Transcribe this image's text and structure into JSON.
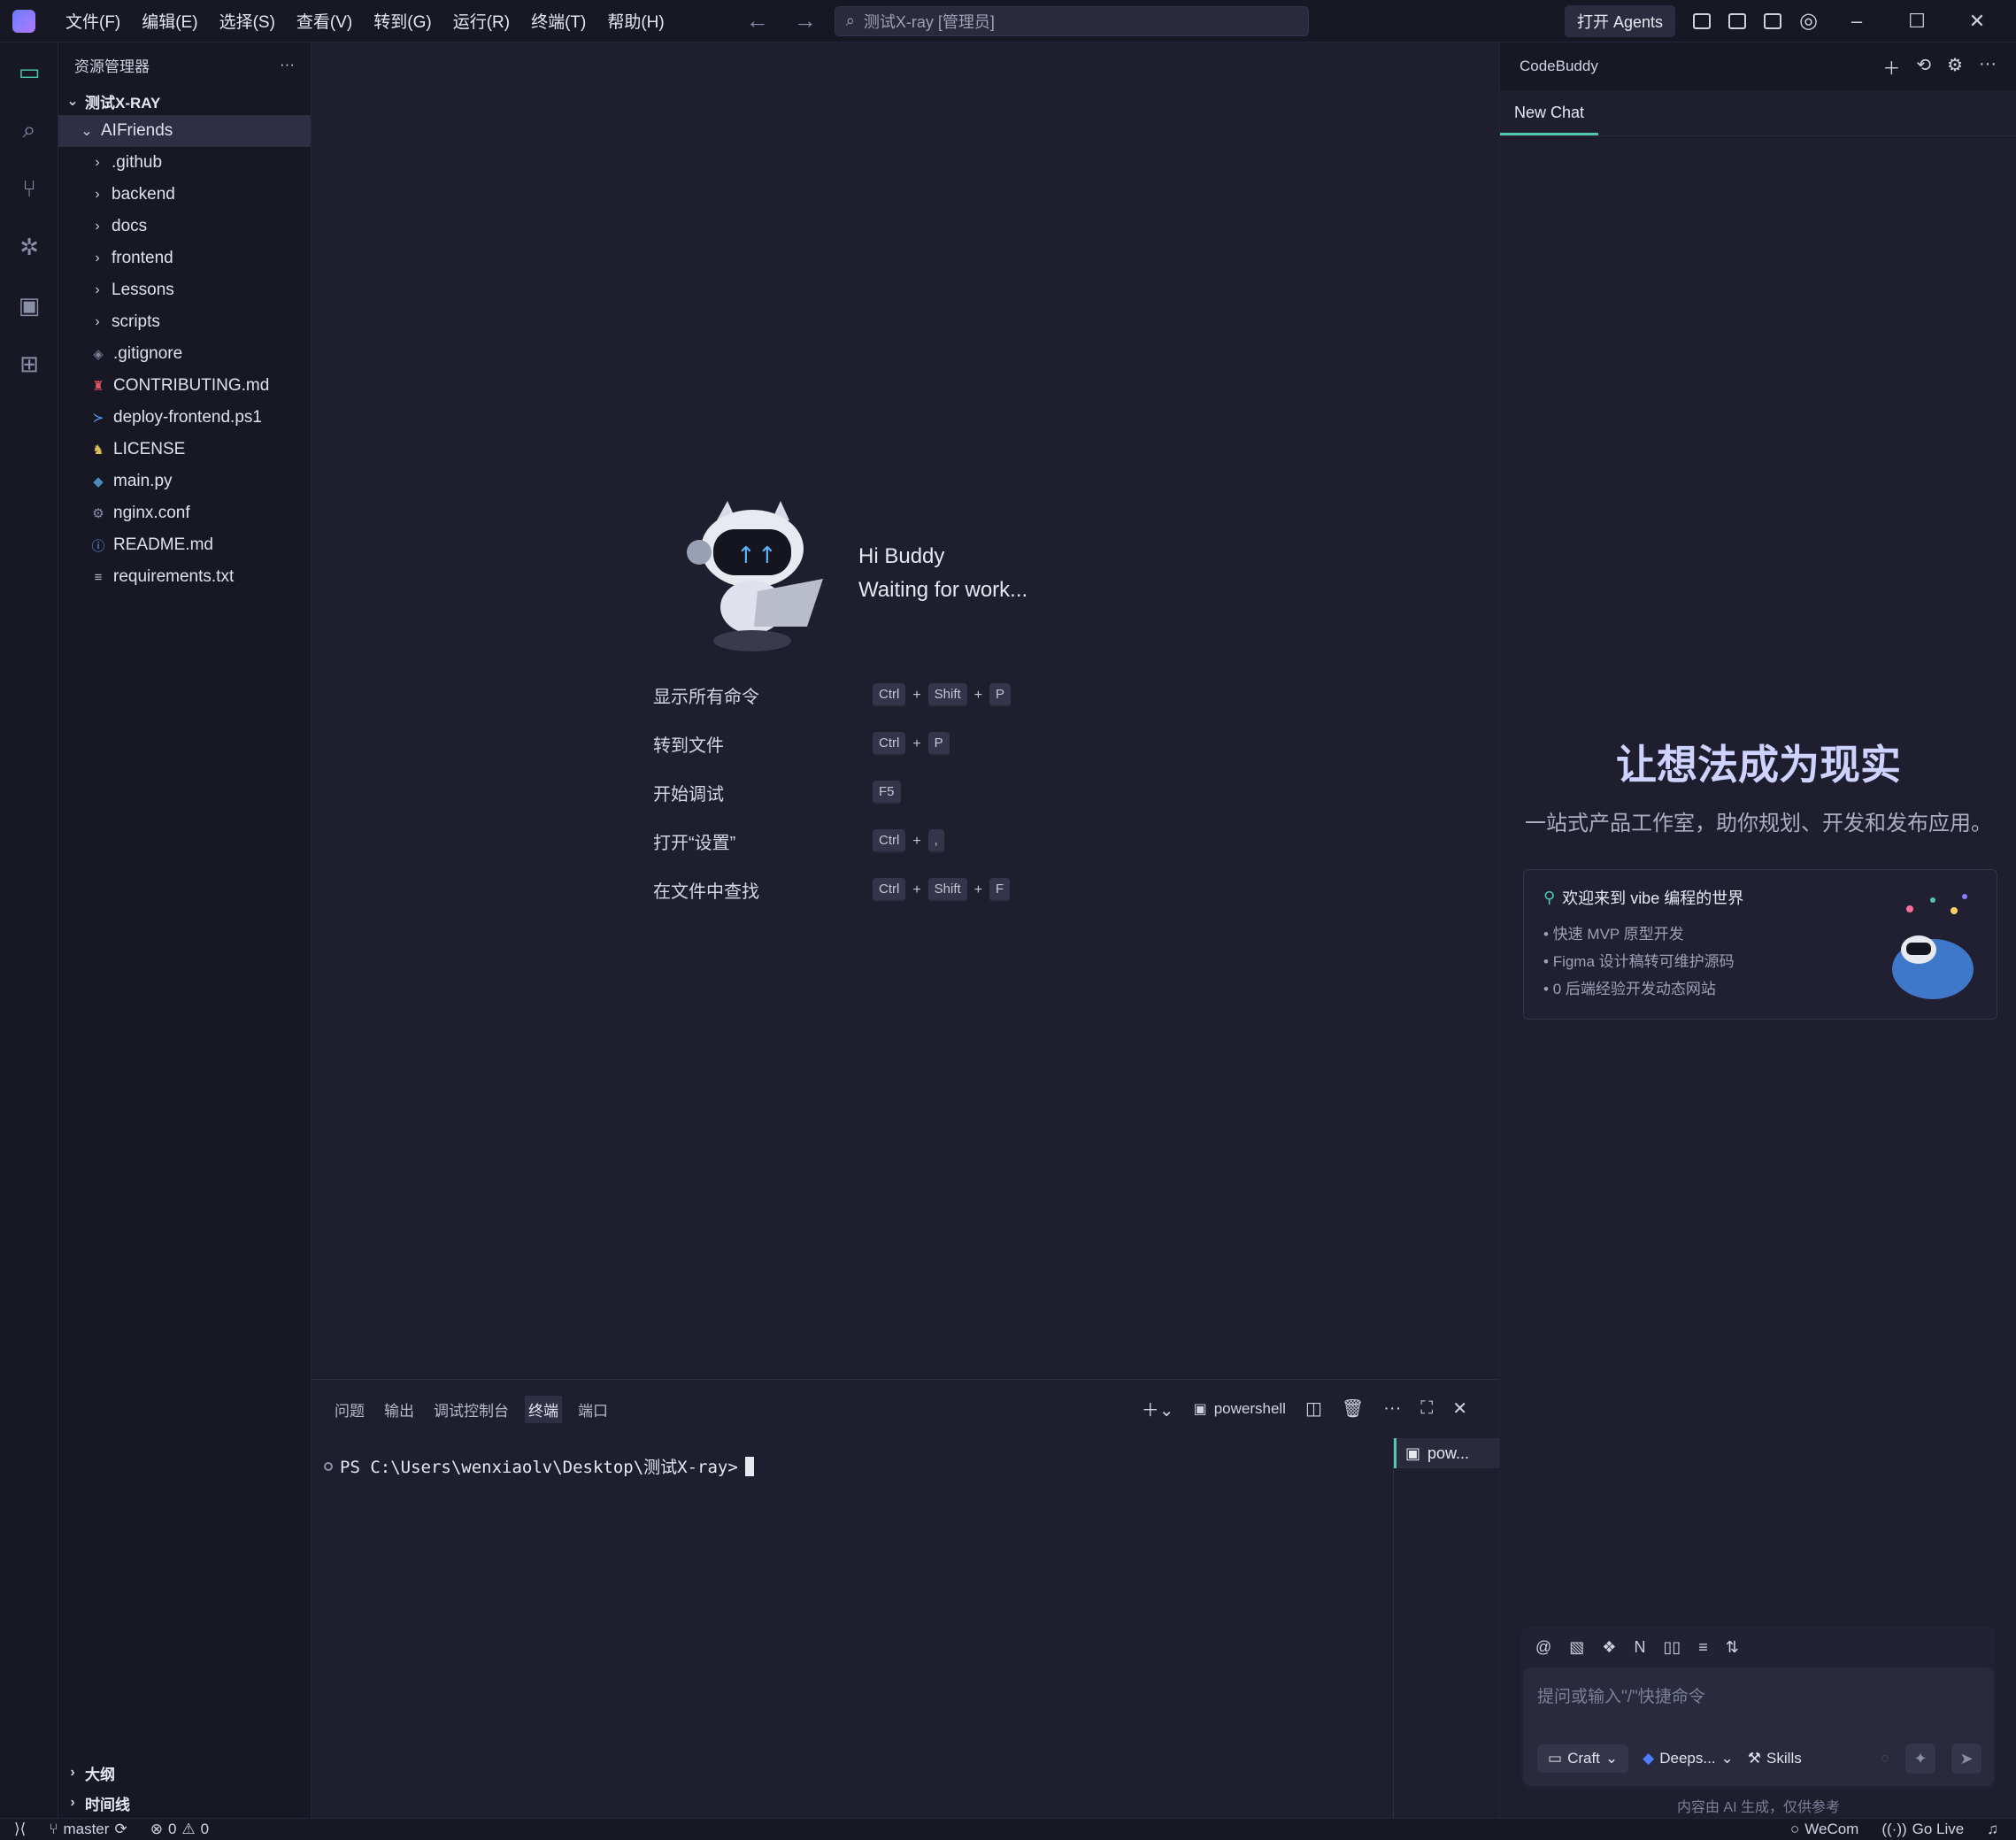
{
  "menu": [
    "文件(F)",
    "编辑(E)",
    "选择(S)",
    "查看(V)",
    "转到(G)",
    "运行(R)",
    "终端(T)",
    "帮助(H)"
  ],
  "search": {
    "value": "测试X-ray [管理员]"
  },
  "titlebar": {
    "agents_label": "打开 Agents"
  },
  "sidebar": {
    "title": "资源管理器",
    "root": "测试X-RAY",
    "folder": "AIFriends",
    "items": [
      {
        "label": ".github",
        "type": "folder"
      },
      {
        "label": "backend",
        "type": "folder"
      },
      {
        "label": "docs",
        "type": "folder"
      },
      {
        "label": "frontend",
        "type": "folder"
      },
      {
        "label": "Lessons",
        "type": "folder"
      },
      {
        "label": "scripts",
        "type": "folder"
      },
      {
        "label": ".gitignore",
        "type": "file",
        "icon": "git-icon"
      },
      {
        "label": "CONTRIBUTING.md",
        "type": "file",
        "icon": "contributing-icon"
      },
      {
        "label": "deploy-frontend.ps1",
        "type": "file",
        "icon": "powershell-icon"
      },
      {
        "label": "LICENSE",
        "type": "file",
        "icon": "license-icon"
      },
      {
        "label": "main.py",
        "type": "file",
        "icon": "python-icon"
      },
      {
        "label": "nginx.conf",
        "type": "file",
        "icon": "gear-icon"
      },
      {
        "label": "README.md",
        "type": "file",
        "icon": "info-icon"
      },
      {
        "label": "requirements.txt",
        "type": "file",
        "icon": "text-icon"
      }
    ],
    "outline": "大纲",
    "timeline": "时间线"
  },
  "welcome": {
    "greeting": "Hi Buddy",
    "status": "Waiting for work...",
    "shortcuts": [
      {
        "label": "显示所有命令",
        "keys": [
          "Ctrl",
          "Shift",
          "P"
        ]
      },
      {
        "label": "转到文件",
        "keys": [
          "Ctrl",
          "P"
        ]
      },
      {
        "label": "开始调试",
        "keys": [
          "F5"
        ]
      },
      {
        "label": "打开“设置”",
        "keys": [
          "Ctrl",
          ","
        ]
      },
      {
        "label": "在文件中查找",
        "keys": [
          "Ctrl",
          "Shift",
          "F"
        ]
      }
    ]
  },
  "panel": {
    "tabs": [
      "问题",
      "输出",
      "调试控制台",
      "终端",
      "端口"
    ],
    "active_tab": "终端",
    "shell": "powershell",
    "prompt": "PS C:\\Users\\wenxiaolv\\Desktop\\测试X-ray>",
    "term_tab": "pow..."
  },
  "codebuddy": {
    "title": "CodeBuddy",
    "tab": "New Chat",
    "hero_title": "让想法成为现实",
    "hero_sub": "一站式产品工作室，助你规划、开发和发布应用。",
    "card_title": "欢迎来到 vibe 编程的世界",
    "card_items": [
      "快速 MVP 原型开发",
      "Figma 设计稿转可维护源码",
      "0 后端经验开发动态网站"
    ],
    "placeholder": "提问或输入\"/\"快捷命令",
    "mode": "Craft",
    "model": "Deeps...",
    "skills": "Skills",
    "ai_note": "内容由 AI 生成，仅供参考"
  },
  "status": {
    "branch": "master",
    "errors": "0",
    "warnings": "0",
    "wecom": "WeCom",
    "golive": "Go Live"
  },
  "colors": {
    "accent": "#4ec9b0",
    "bg": "#1e1e2e",
    "hero": "#cdd2ff"
  }
}
